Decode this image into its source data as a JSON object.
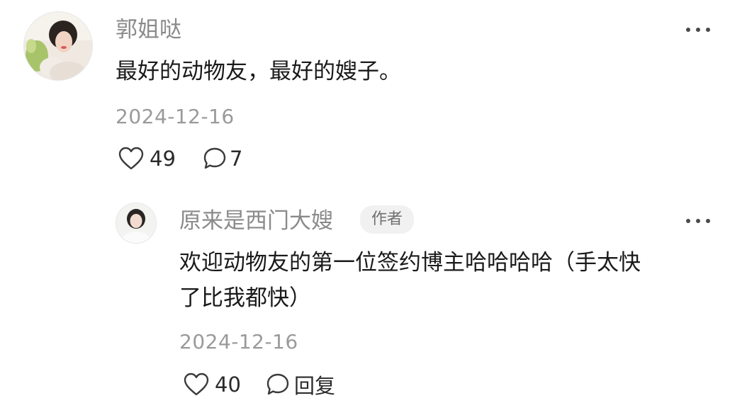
{
  "comment": {
    "username": "郭姐哒",
    "text": "最好的动物友，最好的嫂子。",
    "date": "2024-12-16",
    "likes": "49",
    "replies": "7"
  },
  "reply": {
    "username": "原来是西门大嫂",
    "author_tag": "作者",
    "text_line1": "欢迎动物友的第一位签约博主哈哈哈哈（手太快",
    "text_line2": "了比我都快）",
    "date": "2024-12-16",
    "likes": "40",
    "reply_label": "回复"
  },
  "icons": {
    "like": "heart-outline-icon",
    "comment": "speech-bubble-icon",
    "more": "more-dots-icon"
  },
  "colors": {
    "username": "#8a8a8a",
    "date": "#9a9a9a",
    "text": "#1a1a1a",
    "tag_bg": "#f1f1f1"
  }
}
